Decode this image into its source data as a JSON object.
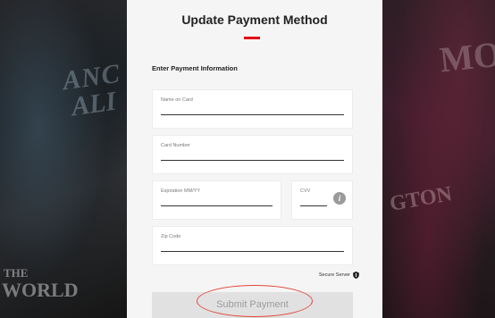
{
  "page": {
    "title": "Update Payment Method",
    "section_label": "Enter Payment Information",
    "accent_color": "#e50914"
  },
  "form": {
    "name_label": "Name on Card",
    "card_label": "Card Number",
    "exp_label": "Expiration MM/YY",
    "cvv_label": "CVV",
    "zip_label": "Zip Code",
    "cvv_info_glyph": "i",
    "secure_text": "Secure Server",
    "submit_label": "Submit Payment"
  },
  "background": {
    "left_poster_1": "ANC",
    "left_poster_2": "ALI",
    "left_poster_3": "THE",
    "left_poster_4": "WORLD",
    "right_poster_1": "MO",
    "right_poster_2": "GTON"
  },
  "icons": {
    "info": "info-icon",
    "shield": "shield-icon"
  }
}
